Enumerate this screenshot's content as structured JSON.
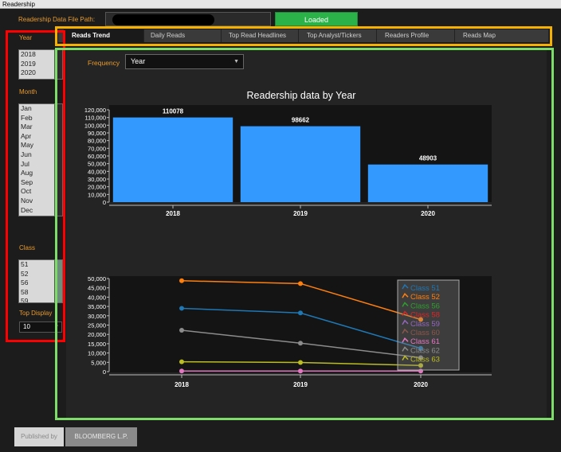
{
  "window": {
    "title": "Readership"
  },
  "header": {
    "file_path_label": "Readership Data File Path:",
    "loaded_label": "Loaded"
  },
  "sidebar": {
    "year_label": "Year",
    "years": [
      "2018",
      "2019",
      "2020"
    ],
    "month_label": "Month",
    "months": [
      "Jan",
      "Feb",
      "Mar",
      "Apr",
      "May",
      "Jun",
      "Jul",
      "Aug",
      "Sep",
      "Oct",
      "Nov",
      "Dec"
    ],
    "class_label": "Class",
    "classes": [
      "51",
      "52",
      "56",
      "58",
      "59"
    ],
    "top_display_label": "Top Display",
    "top_display_value": "10"
  },
  "tabs": [
    "Reads Trend",
    "Daily Reads",
    "Top Read Headlines",
    "Top Analyst/Tickers",
    "Readers Profile",
    "Reads Map"
  ],
  "active_tab": "Reads Trend",
  "controls": {
    "frequency_label": "Frequency",
    "frequency_value": "Year"
  },
  "footer": {
    "published_by_label": "Published by",
    "publisher": "BLOOMBERG L.P."
  },
  "colors": {
    "accent_orange": "#e69a2e",
    "loaded_green": "#2bb34a",
    "bar_blue": "#3399ff"
  },
  "chart_data": [
    {
      "type": "bar",
      "title": "Readership data by Year",
      "categories": [
        "2018",
        "2019",
        "2020"
      ],
      "values": [
        110078,
        98662,
        48903
      ],
      "ylim": [
        0,
        120000
      ],
      "yticks": [
        0,
        10000,
        20000,
        30000,
        40000,
        50000,
        60000,
        70000,
        80000,
        90000,
        100000,
        110000,
        120000
      ],
      "ytick_labels": [
        "0",
        "10,000",
        "20,000",
        "30,000",
        "40,000",
        "50,000",
        "60,000",
        "70,000",
        "80,000",
        "90,000",
        "100,000",
        "110,000",
        "120,000"
      ],
      "grid": false
    },
    {
      "type": "line",
      "categories": [
        "2018",
        "2019",
        "2020"
      ],
      "ylim": [
        0,
        50000
      ],
      "yticks": [
        0,
        5000,
        10000,
        15000,
        20000,
        25000,
        30000,
        35000,
        40000,
        45000,
        50000
      ],
      "ytick_labels": [
        "0",
        "5,000",
        "10,000",
        "15,000",
        "20,000",
        "25,000",
        "30,000",
        "35,000",
        "40,000",
        "45,000",
        "50,000"
      ],
      "legend_position": "top-right",
      "series": [
        {
          "name": "Class 51",
          "color": "#1f77b4",
          "values": [
            34000,
            31500,
            12500
          ]
        },
        {
          "name": "Class 52",
          "color": "#ff7f0e",
          "values": [
            48800,
            47300,
            28000
          ]
        },
        {
          "name": "Class 56",
          "color": "#2ca02c",
          "values": [
            null,
            null,
            null
          ]
        },
        {
          "name": "Class 58",
          "color": "#d62728",
          "values": [
            null,
            null,
            null
          ]
        },
        {
          "name": "Class 59",
          "color": "#9467bd",
          "values": [
            null,
            null,
            null
          ]
        },
        {
          "name": "Class 60",
          "color": "#8c564b",
          "values": [
            null,
            null,
            null
          ]
        },
        {
          "name": "Class 61",
          "color": "#e377c2",
          "values": [
            300,
            300,
            300
          ]
        },
        {
          "name": "Class 62",
          "color": "#8c8c8c",
          "values": [
            22200,
            15300,
            7500
          ]
        },
        {
          "name": "Class 63",
          "color": "#bcbd22",
          "values": [
            5300,
            4900,
            3300
          ]
        }
      ]
    }
  ]
}
